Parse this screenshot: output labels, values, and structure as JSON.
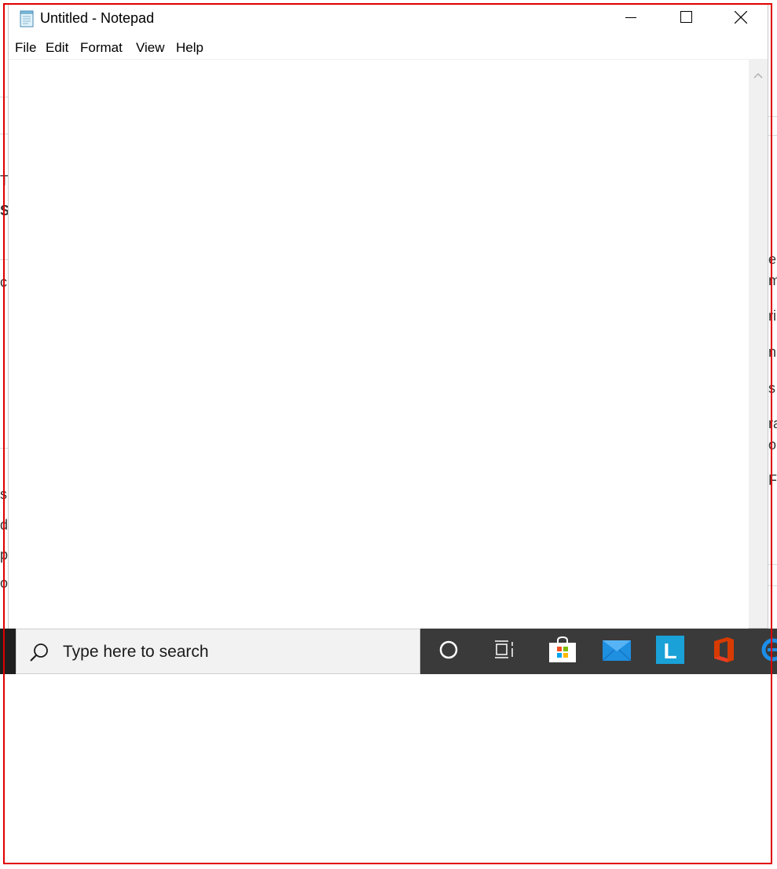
{
  "window": {
    "title": "Untitled - Notepad",
    "menu": [
      "File",
      "Edit",
      "Format",
      "View",
      "Help"
    ],
    "editor_text": ""
  },
  "caption_buttons": [
    "minimize-icon",
    "maximize-icon",
    "close-icon"
  ],
  "taskbar": {
    "search_placeholder": "Type here to search",
    "icons": [
      "cortana-icon",
      "task-view-icon",
      "microsoft-store-icon",
      "mail-icon",
      "l-app-icon",
      "office-icon",
      "edge-icon"
    ]
  },
  "background_fragments": {
    "left": [
      "T",
      "S",
      "c",
      "s",
      "di",
      "p",
      "o"
    ],
    "right": [
      "e",
      "m",
      "ri",
      "n",
      "s",
      "ra",
      "o",
      "Fe"
    ]
  },
  "colors": {
    "taskbar": "#3a3a3a",
    "search_box": "#f2f2f2",
    "screenshot_frame": "#e00000",
    "scrollbar": "#f0f0f0"
  }
}
